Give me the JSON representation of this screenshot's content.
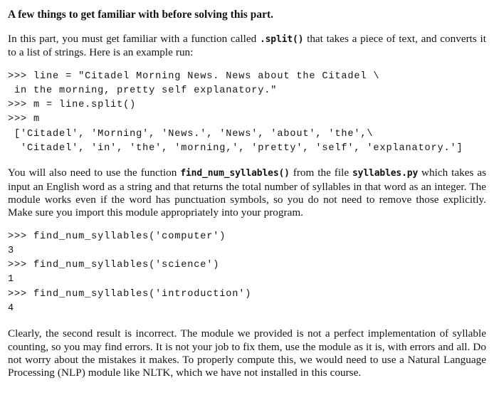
{
  "document": {
    "heading": "A few things to get familiar with before solving this part.",
    "paragraph_1": {
      "before_tt": "In this part, you must get familiar with a function called ",
      "tt": ".split()",
      "after_tt": " that takes a piece of text, and converts it to a list of strings. Here is an example run:"
    },
    "code_block_1": {
      "lines": [
        ">>> line = \"Citadel Morning News. News about the Citadel \\",
        " in the morning, pretty self explanatory.\"",
        ">>> m = line.split()",
        ">>> m",
        " ['Citadel', 'Morning', 'News.', 'News', 'about', 'the',\\",
        "  'Citadel', 'in', 'the', 'morning,', 'pretty', 'self', 'explanatory.']"
      ]
    },
    "paragraph_2": {
      "part_1": "You will also need to use the function ",
      "tt_1": "find_num_syllables()",
      "part_2": " from the file ",
      "tt_2": "syllables.py",
      "part_3": " which takes as input an English word as a string and that returns the total number of syllables in that word as an integer. The module works even if the word has punctuation symbols, so you do not need to remove those explicitly. Make sure you import this module appropriately into your program."
    },
    "code_block_2": {
      "lines": [
        ">>> find_num_syllables('computer')",
        "3",
        ">>> find_num_syllables('science')",
        "1",
        ">>> find_num_syllables('introduction')",
        "4"
      ]
    },
    "paragraph_3": "Clearly, the second result is incorrect.  The module we provided is not a perfect implementation of syllable counting, so you may find errors.  It is not your job to fix them, use the module as it is, with errors and all.  Do not worry about the mistakes it makes.  To properly compute this, we would need to use a Natural Language Processing (NLP) module like NLTK, which we have not installed in this course."
  }
}
